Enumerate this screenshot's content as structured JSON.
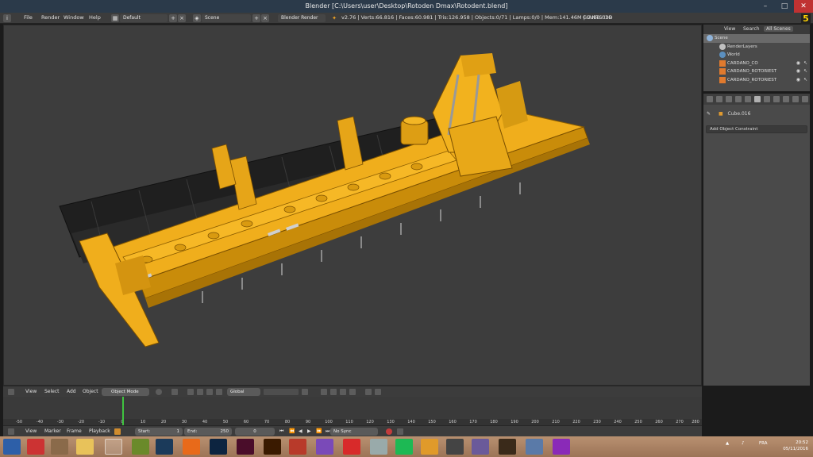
{
  "window": {
    "title": "Blender [C:\\Users\\user\\Desktop\\Rotoden Dmax\\Rotodent.blend]",
    "minimize": "–",
    "maximize": "□",
    "close": "✕"
  },
  "info_header": {
    "menus": [
      "File",
      "Render",
      "Window",
      "Help"
    ],
    "layout": "Default",
    "scene": "Scene",
    "engine": "Blender Render",
    "stats": "v2.76 | Verts:66.816 | Faces:60.981 | Tris:126.958 | Objects:0/71 | Lamps:0/0 | Mem:141.46M | Cube.016",
    "addon_label": "GIANTS I3D",
    "badge": "5"
  },
  "outliner": {
    "tabs": [
      "View",
      "Search",
      "All Scenes"
    ],
    "rows": [
      {
        "label": "Scene",
        "icon": "scene-icon"
      },
      {
        "label": "RenderLayers",
        "icon": "renderlayers-icon"
      },
      {
        "label": "World",
        "icon": "world-icon"
      },
      {
        "label": "CARDANO_CO",
        "icon": "mesh-icon"
      },
      {
        "label": "CARDANO_ROTORIEST",
        "icon": "mesh-icon"
      },
      {
        "label": "CARDANO_ROTORIEST",
        "icon": "mesh-icon"
      }
    ]
  },
  "properties": {
    "object_name": "Cube.016",
    "constraint_dropdown": "Add Object Constraint"
  },
  "viewport_header": {
    "menus": [
      "View",
      "Select",
      "Add",
      "Object"
    ],
    "mode": "Object Mode",
    "orientation": "Global"
  },
  "timeline": {
    "ticks": [
      "-50",
      "-40",
      "-30",
      "-20",
      "-10",
      "0",
      "10",
      "20",
      "30",
      "40",
      "50",
      "60",
      "70",
      "80",
      "90",
      "100",
      "110",
      "120",
      "130",
      "140",
      "150",
      "160",
      "170",
      "180",
      "190",
      "200",
      "210",
      "220",
      "230",
      "240",
      "250",
      "260",
      "270",
      "280"
    ],
    "current_frame": 0,
    "menus": [
      "View",
      "Marker",
      "Frame",
      "Playback"
    ],
    "start_label": "Start:",
    "start_value": "1",
    "end_label": "End:",
    "end_value": "250",
    "frame_value": "0",
    "sync": "No Sync"
  },
  "taskbar": {
    "tray_lang": "FRA",
    "time": "20:52",
    "date": "05/11/2016"
  },
  "colors": {
    "model_yellow": "#e8a514",
    "model_black": "#222222",
    "viewport_bg": "#3d3d3d",
    "playhead": "#3fc33f"
  }
}
